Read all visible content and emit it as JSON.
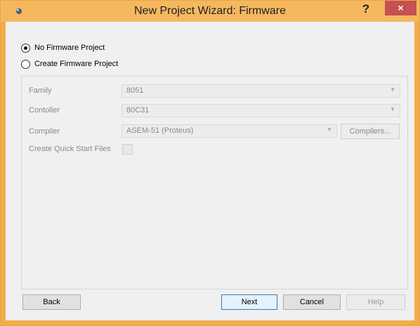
{
  "window": {
    "title": "New Project Wizard: Firmware",
    "help_icon": "?",
    "close_icon": "×"
  },
  "options": {
    "no_firmware": "No Firmware Project",
    "create_firmware": "Create Firmware Project",
    "selected": "no_firmware"
  },
  "fields": {
    "family_label": "Family",
    "family_value": "8051",
    "controller_label": "Contoller",
    "controller_value": "80C31",
    "compiler_label": "Compiler",
    "compiler_value": "ASEM-51 (Proteus)",
    "compilers_button": "Compilers...",
    "quickstart_label": "Create Quick Start Files"
  },
  "buttons": {
    "back": "Back",
    "next": "Next",
    "cancel": "Cancel",
    "help": "Help"
  },
  "icons": {
    "app": "proteus-app-icon",
    "dropdown": "chevron-down-icon"
  },
  "colors": {
    "titlebar": "#f5b85f",
    "close_button": "#c75050",
    "dialog_bg": "#f0f0f0"
  }
}
